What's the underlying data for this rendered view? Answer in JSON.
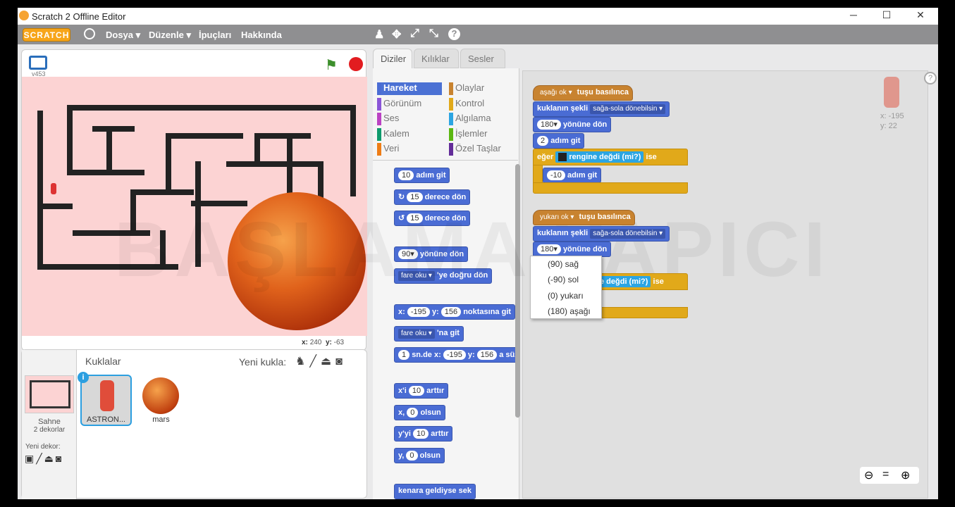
{
  "window": {
    "title": "Scratch 2 Offline Editor",
    "min": "─",
    "max": "☐",
    "close": "✕"
  },
  "menu": {
    "logo": "SCRATCH",
    "file": "Dosya ▾",
    "edit": "Düzenle ▾",
    "tips": "İpuçları",
    "about": "Hakkında"
  },
  "stage": {
    "version": "v453",
    "mouse_x_label": "x:",
    "mouse_x": "240",
    "mouse_y_label": "y:",
    "mouse_y": "-63"
  },
  "sprites": {
    "header": "Kuklalar",
    "new_sprite": "Yeni kukla:",
    "stage_label": "Sahne",
    "stage_backdrops": "2 dekorlar",
    "new_backdrop": "Yeni dekor:",
    "items": [
      {
        "name": "ASTRON..."
      },
      {
        "name": "mars"
      }
    ]
  },
  "tabs": [
    "Diziler",
    "Kılıklar",
    "Sesler"
  ],
  "categories": {
    "left": [
      "Hareket",
      "Görünüm",
      "Ses",
      "Kalem",
      "Veri"
    ],
    "right": [
      "Olaylar",
      "Kontrol",
      "Algılama",
      "İşlemler",
      "Özel Taşlar"
    ],
    "left_colors": [
      "#4a6cd4",
      "#8a55d7",
      "#bb42c3",
      "#0e9a6c",
      "#ee7d16"
    ],
    "right_colors": [
      "#c88330",
      "#e1a91a",
      "#2ca5e2",
      "#5cb712",
      "#632d99"
    ]
  },
  "palette": {
    "move": {
      "n": "10",
      "t": "adım git"
    },
    "turn_r": {
      "n": "15",
      "t": "derece dön"
    },
    "turn_l": {
      "n": "15",
      "t": "derece dön"
    },
    "point_dir": {
      "n": "90▾",
      "t": "yönüne dön"
    },
    "point_to": {
      "d": "fare oku ▾",
      "t": "'ye doğru dön"
    },
    "goto_xy": {
      "x": "x:",
      "xv": "-195",
      "y": "y:",
      "yv": "156",
      "t": "noktasına git"
    },
    "goto": {
      "d": "fare oku ▾",
      "t": "'na git"
    },
    "glide": {
      "n": "1",
      "t1": "sn.de x:",
      "xv": "-195",
      "t2": "y:",
      "yv": "156",
      "t3": "a süz"
    },
    "change_x": {
      "t1": "x'i",
      "n": "10",
      "t2": "arttır"
    },
    "set_x": {
      "t1": "x,",
      "n": "0",
      "t2": "olsun"
    },
    "change_y": {
      "t1": "y'yi",
      "n": "10",
      "t2": "arttır"
    },
    "set_y": {
      "t1": "y,",
      "n": "0",
      "t2": "olsun"
    },
    "bounce": "kenara geldiyse sek"
  },
  "script1": {
    "hat_key": "aşağı ok ▾",
    "hat_t": "tuşu basılınca",
    "rot_t": "kuklanın şekli",
    "rot_d": "sağa-sola dönebilsin ▾",
    "dir_n": "180▾",
    "dir_t": "yönüne dön",
    "mv_n": "2",
    "mv_t": "adım git",
    "if_t": "eğer",
    "touch_t": "rengine değdi (mi?)",
    "ise": "ise",
    "back_n": "-10",
    "back_t": "adım git"
  },
  "script2": {
    "hat_key": "yukarı ok ▾",
    "hat_t": "tuşu basılınca",
    "rot_t": "kuklanın şekli",
    "rot_d": "sağa-sola dönebilsin ▾",
    "dir_n": "180▾",
    "dir_t": "yönüne dön",
    "touch_t": "e değdi (mi?)",
    "ise": "ise",
    "back_t": "t"
  },
  "dropdown": [
    "(90) sağ",
    "(-90) sol",
    "(0) yukarı",
    "(180) aşağı"
  ],
  "sprite_info": {
    "x": "x: -195",
    "y": "y: 22"
  },
  "watermark": "BAŞLAMA YAPICI"
}
